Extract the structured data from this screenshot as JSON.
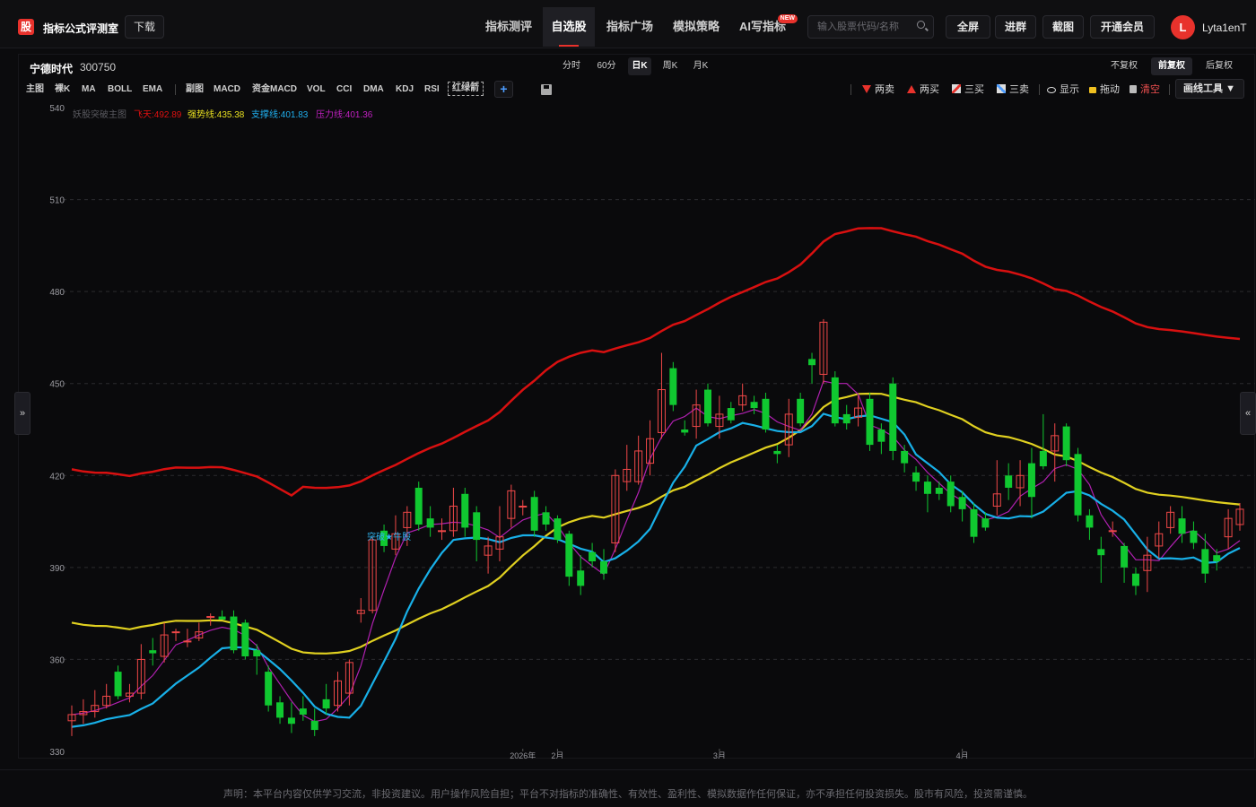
{
  "header": {
    "logo_char": "股",
    "app_title": "指标公式评测室",
    "download_label": "下载",
    "nav": [
      {
        "label": "指标测评",
        "active": false
      },
      {
        "label": "自选股",
        "active": true
      },
      {
        "label": "指标广场",
        "active": false
      },
      {
        "label": "模拟策略",
        "active": false
      },
      {
        "label": "AI写指标",
        "active": false,
        "badge": "NEW"
      }
    ],
    "search_placeholder": "输入股票代码/名称",
    "buttons": [
      "全屏",
      "进群",
      "截图",
      "开通会员"
    ],
    "avatar_initial": "L",
    "username": "Lyta1enT",
    "accent_color": "#e8322c"
  },
  "stock": {
    "name": "宁德时代",
    "code": "300750"
  },
  "periods": [
    {
      "label": "分时",
      "active": false
    },
    {
      "label": "60分",
      "active": false
    },
    {
      "label": "日K",
      "active": true
    },
    {
      "label": "周K",
      "active": false
    },
    {
      "label": "月K",
      "active": false
    }
  ],
  "adjust": [
    {
      "label": "不复权",
      "active": false
    },
    {
      "label": "前复权",
      "active": true
    },
    {
      "label": "后复权",
      "active": false
    }
  ],
  "indicators_main_label": "主图",
  "indicators_main": [
    "裸K",
    "MA",
    "BOLL",
    "EMA"
  ],
  "indicators_sub_label": "副图",
  "indicators_sub": [
    "MACD",
    "资金MACD",
    "VOL",
    "CCI",
    "DMA",
    "KDJ",
    "RSI"
  ],
  "indicator_custom": "红绿箭",
  "draw_tools": [
    {
      "label": "两卖",
      "icon": "triangle-down-icon"
    },
    {
      "label": "两买",
      "icon": "triangle-up-icon"
    },
    {
      "label": "三买",
      "icon": "line-draw-icon"
    },
    {
      "label": "三卖",
      "icon": "line-draw-icon"
    },
    {
      "label": "显示",
      "icon": "eye-icon"
    },
    {
      "label": "拖动",
      "icon": "lock-icon"
    },
    {
      "label": "清空",
      "icon": "trash-icon"
    }
  ],
  "draw_tools_menu": "画线工具",
  "legend": {
    "name": "妖股突破主图",
    "items": [
      {
        "label": "飞天:492.89",
        "color": "#e01010"
      },
      {
        "label": "强势线:435.38",
        "color": "#e8e020"
      },
      {
        "label": "支撑线:401.83",
        "color": "#20b0f0"
      },
      {
        "label": "压力线:401.36",
        "color": "#c020c0"
      }
    ]
  },
  "chart_annotation": "突破★牛股",
  "chart_data": {
    "type": "candlestick",
    "y_ticks": [
      540,
      510,
      480,
      450,
      420,
      390,
      360,
      330
    ],
    "ylim": [
      330,
      540
    ],
    "x_labels": [
      {
        "label": "2026年",
        "index": 39
      },
      {
        "label": "2月",
        "index": 42
      },
      {
        "label": "3月",
        "index": 56
      },
      {
        "label": "4月",
        "index": 77
      }
    ],
    "up_color": "#f04848",
    "down_color": "#10c830",
    "candles": [
      [
        340,
        342,
        345,
        335
      ],
      [
        342,
        343,
        347,
        339
      ],
      [
        343,
        345,
        350,
        341
      ],
      [
        345,
        348,
        352,
        344
      ],
      [
        356,
        348,
        358,
        347
      ],
      [
        348,
        349,
        352,
        346
      ],
      [
        349,
        360,
        365,
        347
      ],
      [
        363,
        362,
        367,
        358
      ],
      [
        361,
        368,
        372,
        359
      ],
      [
        369,
        369,
        370,
        366
      ],
      [
        366,
        366,
        370,
        364
      ],
      [
        367,
        369,
        372,
        366
      ],
      [
        374,
        374,
        375,
        371
      ],
      [
        374,
        373,
        376,
        373
      ],
      [
        374,
        363,
        376,
        362
      ],
      [
        372,
        361,
        373,
        360
      ],
      [
        363,
        361,
        365,
        355
      ],
      [
        356,
        345,
        358,
        343
      ],
      [
        346,
        341,
        348,
        339
      ],
      [
        341,
        339,
        346,
        336
      ],
      [
        344,
        342,
        348,
        340
      ],
      [
        340,
        337,
        344,
        335
      ],
      [
        347,
        344,
        352,
        342
      ],
      [
        345,
        353,
        356,
        343
      ],
      [
        349,
        359,
        360,
        345
      ],
      [
        375,
        376,
        380,
        372
      ],
      [
        376,
        399,
        400,
        375
      ],
      [
        402,
        397,
        404,
        395
      ],
      [
        396,
        401,
        407,
        394
      ],
      [
        403,
        408,
        410,
        397
      ],
      [
        416,
        404,
        418,
        402
      ],
      [
        406,
        403,
        410,
        400
      ],
      [
        402,
        402,
        406,
        399
      ],
      [
        402,
        410,
        416,
        400
      ],
      [
        414,
        403,
        416,
        400
      ],
      [
        408,
        399,
        410,
        392
      ],
      [
        394,
        397,
        400,
        388
      ],
      [
        396,
        400,
        410,
        392
      ],
      [
        406,
        415,
        417,
        403
      ],
      [
        410,
        410,
        412,
        407
      ],
      [
        413,
        402,
        415,
        400
      ],
      [
        408,
        404,
        410,
        402
      ],
      [
        406,
        399,
        407,
        398
      ],
      [
        401,
        387,
        402,
        384
      ],
      [
        389,
        384,
        394,
        381
      ],
      [
        395,
        392,
        398,
        390
      ],
      [
        392,
        388,
        396,
        386
      ],
      [
        398,
        420,
        422,
        395
      ],
      [
        418,
        422,
        430,
        415
      ],
      [
        418,
        428,
        433,
        417
      ],
      [
        424,
        432,
        438,
        420
      ],
      [
        434,
        448,
        460,
        432
      ],
      [
        455,
        443,
        457,
        441
      ],
      [
        435,
        434,
        438,
        433
      ],
      [
        436,
        443,
        448,
        432
      ],
      [
        448,
        437,
        450,
        436
      ],
      [
        436,
        440,
        446,
        432
      ],
      [
        442,
        438,
        444,
        437
      ],
      [
        443,
        446,
        450,
        441
      ],
      [
        444,
        442,
        446,
        440
      ],
      [
        445,
        435,
        447,
        434
      ],
      [
        428,
        427,
        430,
        424
      ],
      [
        430,
        440,
        445,
        426
      ],
      [
        445,
        437,
        447,
        436
      ],
      [
        458,
        456,
        460,
        450
      ],
      [
        453,
        470,
        471,
        450
      ],
      [
        452,
        437,
        454,
        436
      ],
      [
        440,
        437,
        443,
        435
      ],
      [
        439,
        442,
        446,
        436
      ],
      [
        445,
        430,
        447,
        428
      ],
      [
        435,
        431,
        437,
        427
      ],
      [
        450,
        428,
        452,
        425
      ],
      [
        428,
        424,
        430,
        421
      ],
      [
        421,
        418,
        423,
        415
      ],
      [
        418,
        414,
        420,
        408
      ],
      [
        416,
        414,
        418,
        412
      ],
      [
        418,
        410,
        420,
        408
      ],
      [
        413,
        409,
        415,
        405
      ],
      [
        409,
        400,
        411,
        398
      ],
      [
        406,
        403,
        408,
        402
      ],
      [
        410,
        414,
        425,
        407
      ],
      [
        420,
        416,
        424,
        412
      ],
      [
        416,
        420,
        425,
        410
      ],
      [
        424,
        413,
        429,
        406
      ],
      [
        428,
        423,
        440,
        422
      ],
      [
        428,
        433,
        437,
        418
      ],
      [
        436,
        425,
        437,
        423
      ],
      [
        427,
        407,
        429,
        405
      ],
      [
        407,
        403,
        409,
        399
      ],
      [
        396,
        394,
        400,
        385
      ],
      [
        402,
        402,
        405,
        400
      ],
      [
        397,
        390,
        398,
        385
      ],
      [
        388,
        384,
        390,
        381
      ],
      [
        389,
        394,
        400,
        382
      ],
      [
        397,
        401,
        405,
        393
      ],
      [
        403,
        408,
        410,
        401
      ],
      [
        406,
        401,
        410,
        398
      ],
      [
        402,
        398,
        405,
        396
      ],
      [
        396,
        388,
        401,
        385
      ],
      [
        394,
        392,
        396,
        389
      ],
      [
        400,
        406,
        409,
        396
      ],
      [
        404,
        409,
        411,
        402
      ]
    ]
  }
}
